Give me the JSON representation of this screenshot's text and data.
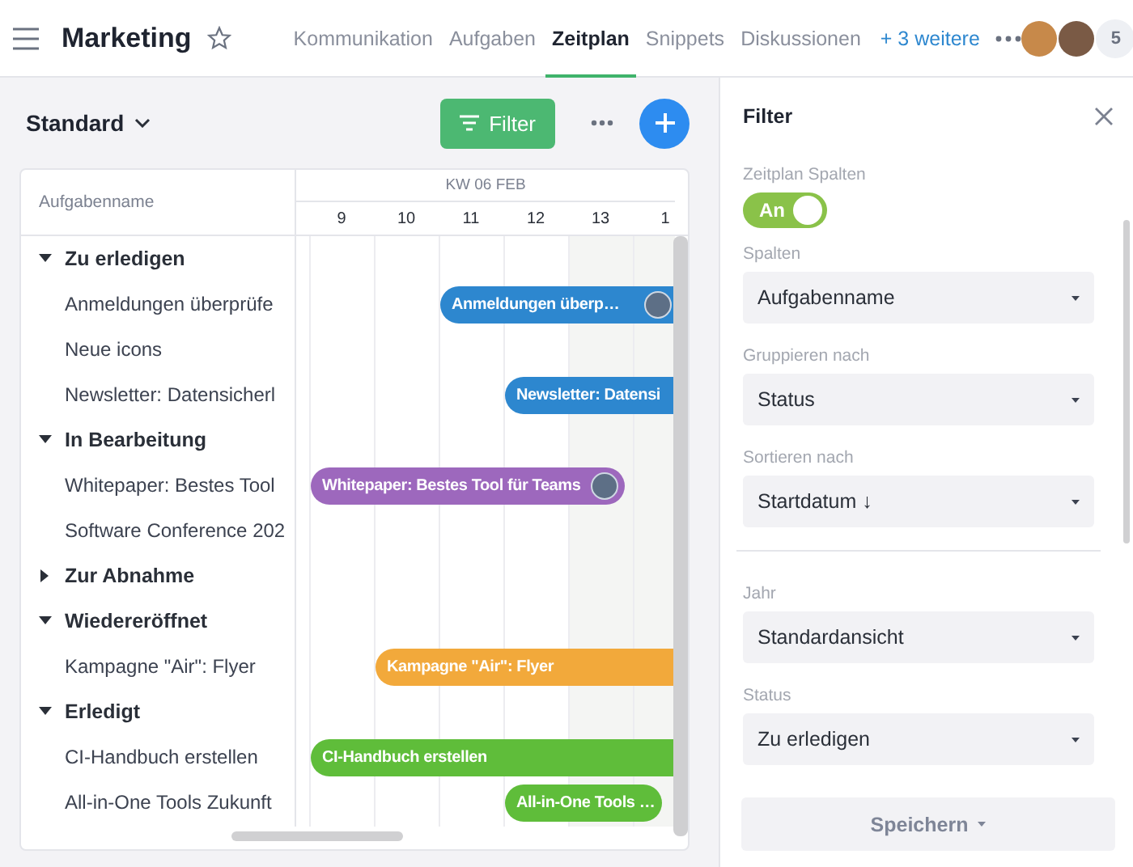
{
  "header": {
    "title": "Marketing",
    "favorite": false,
    "tabs": [
      {
        "label": "Kommunikation",
        "selected": false
      },
      {
        "label": "Aufgaben",
        "selected": false
      },
      {
        "label": "Zeitplan",
        "selected": true
      },
      {
        "label": "Snippets",
        "selected": false
      },
      {
        "label": "Diskussionen",
        "selected": false
      }
    ],
    "more_tabs": "+ 3 weitere",
    "member_count": "5"
  },
  "toolbar": {
    "view": "Standard",
    "filter_button": "Filter"
  },
  "timeline": {
    "name_column": "Aufgabenname",
    "week": "KW 06 FEB",
    "days": [
      {
        "label": "9",
        "weekend": false
      },
      {
        "label": "10",
        "weekend": false
      },
      {
        "label": "11",
        "weekend": false
      },
      {
        "label": "12",
        "weekend": false
      },
      {
        "label": "13",
        "weekend": true
      },
      {
        "label": "1",
        "weekend": true
      }
    ],
    "groups": [
      {
        "name": "Zu erledigen",
        "expanded": true,
        "tasks": [
          {
            "name": "Anmeldungen überprüfe",
            "bar": {
              "label": "Anmeldungen überp…",
              "color": "#2d87cf",
              "avatar": true
            }
          },
          {
            "name": "Neue icons"
          },
          {
            "name": "Newsletter: Datensicherl",
            "bar": {
              "label": "Newsletter: Datensi",
              "color": "#2d87cf"
            }
          }
        ]
      },
      {
        "name": "In Bearbeitung",
        "expanded": true,
        "tasks": [
          {
            "name": "Whitepaper: Bestes Tool",
            "bar": {
              "label": "Whitepaper: Bestes Tool für Teams",
              "color": "#9d68bd",
              "avatar": true
            }
          },
          {
            "name": "Software Conference 202"
          }
        ]
      },
      {
        "name": "Zur Abnahme",
        "expanded": false
      },
      {
        "name": "Wiedereröffnet",
        "expanded": true,
        "tasks": [
          {
            "name": "Kampagne \"Air\": Flyer",
            "bar": {
              "label": "Kampagne \"Air\": Flyer",
              "color": "#f2a93b"
            }
          }
        ]
      },
      {
        "name": "Erledigt",
        "expanded": true,
        "tasks": [
          {
            "name": "CI-Handbuch erstellen",
            "bar": {
              "label": "CI-Handbuch erstellen",
              "color": "#5fbd3a"
            }
          },
          {
            "name": "All-in-One Tools Zukunft",
            "bar": {
              "label": "All-in-One Tools …",
              "color": "#5fbd3a"
            }
          }
        ]
      }
    ]
  },
  "filter_panel": {
    "title": "Filter",
    "fields": [
      {
        "kind": "toggle",
        "label": "Zeitplan Spalten",
        "value": "An",
        "on": true
      },
      {
        "kind": "select",
        "label": "Spalten",
        "value": "Aufgabenname"
      },
      {
        "kind": "select",
        "label": "Gruppieren nach",
        "value": "Status"
      },
      {
        "kind": "select",
        "label": "Sortieren nach",
        "value": "Startdatum ↓"
      },
      {
        "kind": "divider"
      },
      {
        "kind": "select",
        "label": "Jahr",
        "value": "Standardansicht"
      },
      {
        "kind": "select",
        "label": "Status",
        "value": "Zu erledigen"
      }
    ],
    "save_button": "Speichern"
  }
}
